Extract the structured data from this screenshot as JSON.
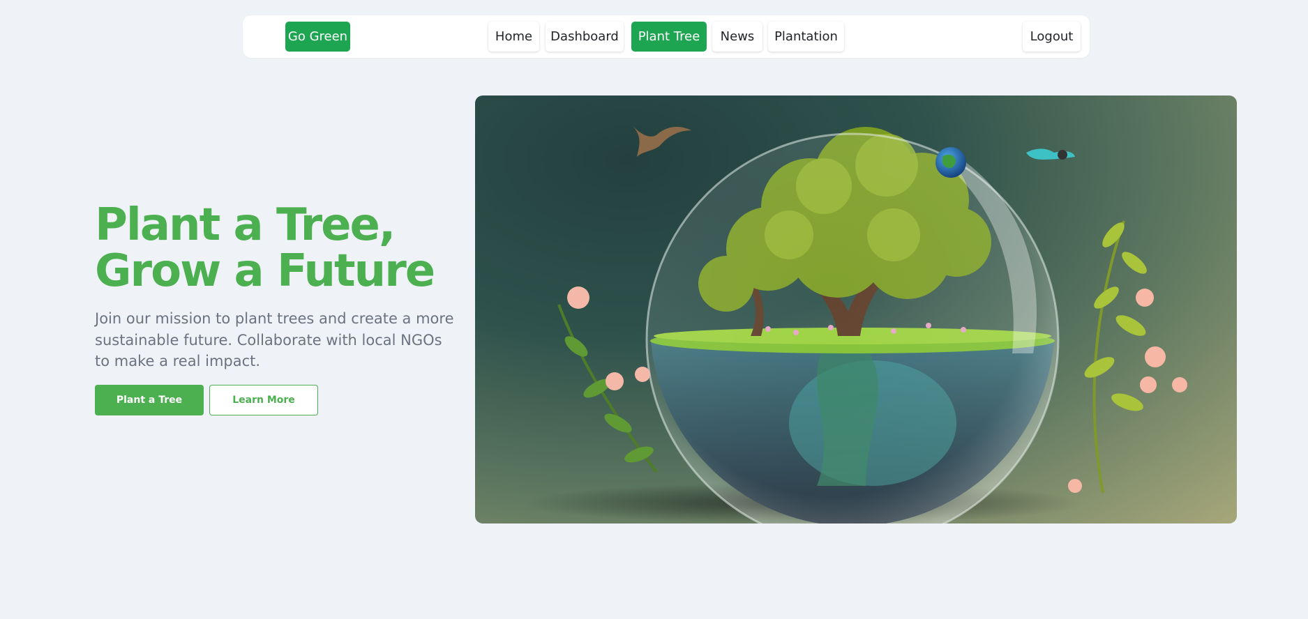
{
  "nav": {
    "brand": "Go Green",
    "links": [
      {
        "label": "Home",
        "active": false
      },
      {
        "label": "Dashboard",
        "active": false
      },
      {
        "label": "Plant Tree",
        "active": true
      },
      {
        "label": "News",
        "active": false
      },
      {
        "label": "Plantation",
        "active": false
      }
    ],
    "logout": "Logout"
  },
  "hero": {
    "title_line1": "Plant a Tree,",
    "title_line2": "Grow a Future",
    "description": "Join our mission to plant trees and create a more sustainable future. Collaborate with local NGOs to make a real impact.",
    "primary_button": "Plant a Tree",
    "secondary_button": "Learn More"
  },
  "colors": {
    "page_background": "#eff3f8",
    "brand_green": "#1da552",
    "hero_green": "#4caf50",
    "body_text": "#6b7280"
  },
  "image": {
    "subject": "glass terrarium globe with tree, flowers, birds and small earth"
  }
}
